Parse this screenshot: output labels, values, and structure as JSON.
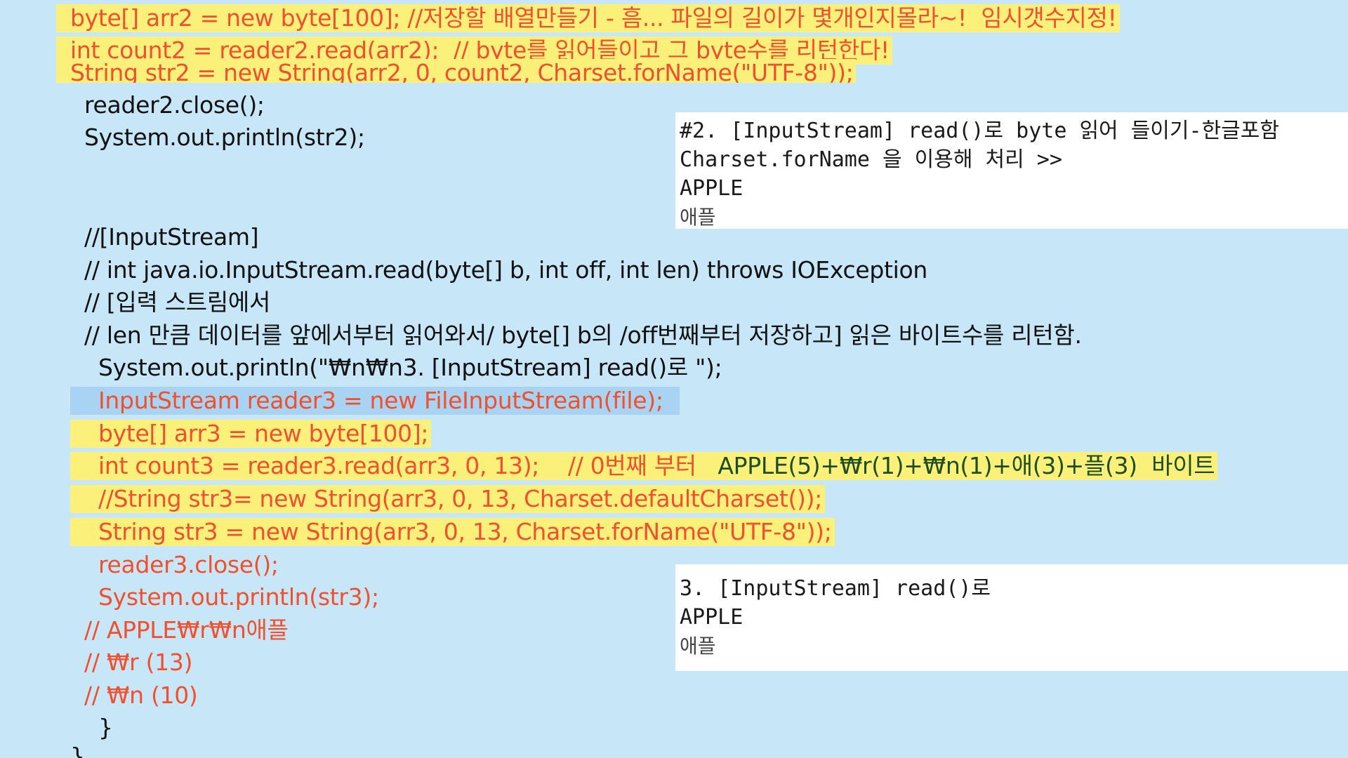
{
  "code": {
    "l1": "byte[] arr2 = new byte[100]; //저장할 배열만들기 - 흠... 파일의 길이가 몇개인지몰라~!  임시갯수지정!",
    "l2": "int count2 = reader2.read(arr2);  // byte를 읽어들이고 그 byte수를 리턴한다!",
    "l3": "String str2 = new String(arr2, 0, count2, Charset.forName(\"UTF-8\"));",
    "l4": "reader2.close();",
    "l5": "System.out.println(str2);",
    "l6": "//[InputStream]",
    "l7": "// int java.io.InputStream.read(byte[] b, int off, int len) throws IOException",
    "l8": "// [입력 스트림에서",
    "l9": "// len 만큼 데이터를 앞에서부터 읽어와서/ byte[] b의 /off번째부터 저장하고] 읽은 바이트수를 리턴함.",
    "l10": "System.out.println(\"₩n₩n3. [InputStream] read()로 \");",
    "l11": "InputStream reader3 = new FileInputStream(file);",
    "l12": "byte[] arr3 = new byte[100];",
    "l13a": "int count3 = reader3.read(arr3, 0, 13);    // 0번째 부터   ",
    "l13b": "APPLE(5)+₩r(1)+₩n(1)+애(3)+플(3)  바이트",
    "l14": "//String str3= new String(arr3, 0, 13, Charset.defaultCharset());",
    "l15": "String str3 = new String(arr3, 0, 13, Charset.forName(\"UTF-8\"));",
    "l16": "reader3.close();",
    "l17": "System.out.println(str3);",
    "l18": "// APPLE₩r₩n애플",
    "l19": "// ₩r (13)",
    "l20": "// ₩n (10)",
    "l21": "}",
    "l22": "}"
  },
  "console1": {
    "line1": "#2. [InputStream] read()로 byte 읽어 들이기-한글포함",
    "line2": "Charset.forName 을 이용해 처리 >>",
    "line3": "APPLE",
    "line4": "애플"
  },
  "console2": {
    "line1": "3. [InputStream] read()로",
    "line2": "APPLE",
    "line3": "애플"
  },
  "colors": {
    "background": "#c7e6f7",
    "highlight_yellow": "#fbf07a",
    "highlight_blue": "#a9d3f2",
    "text_red": "#f0502e",
    "text_dark": "#111111"
  }
}
